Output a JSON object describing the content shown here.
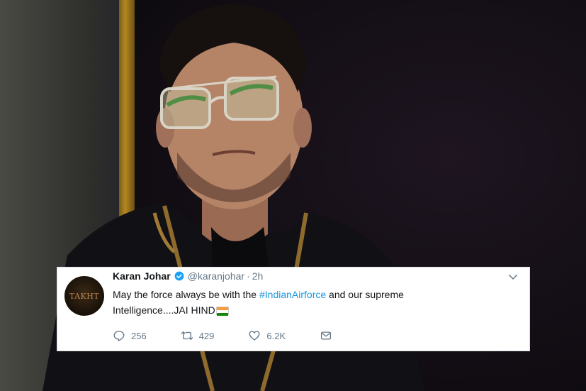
{
  "tweet": {
    "author_name": "Karan Johar",
    "handle": "@karanjohar",
    "separator": "·",
    "time": "2h",
    "text_prefix": "May the force always be with the ",
    "hashtag": "#IndianAirforce",
    "text_suffix": " and our supreme",
    "text_line2": "Intelligence....JAI HIND",
    "avatar_text": "TAKHT",
    "colors": {
      "hashtag": "#1b95e0",
      "secondary": "#657786",
      "primary_text": "#14171a",
      "verified": "#1da1f2"
    },
    "actions": {
      "replies": "256",
      "retweets": "429",
      "likes": "6.2K"
    },
    "icons": [
      "reply-icon",
      "retweet-icon",
      "like-icon",
      "direct-message-icon",
      "verified-badge-icon",
      "chevron-down-icon",
      "india-flag-icon"
    ]
  }
}
